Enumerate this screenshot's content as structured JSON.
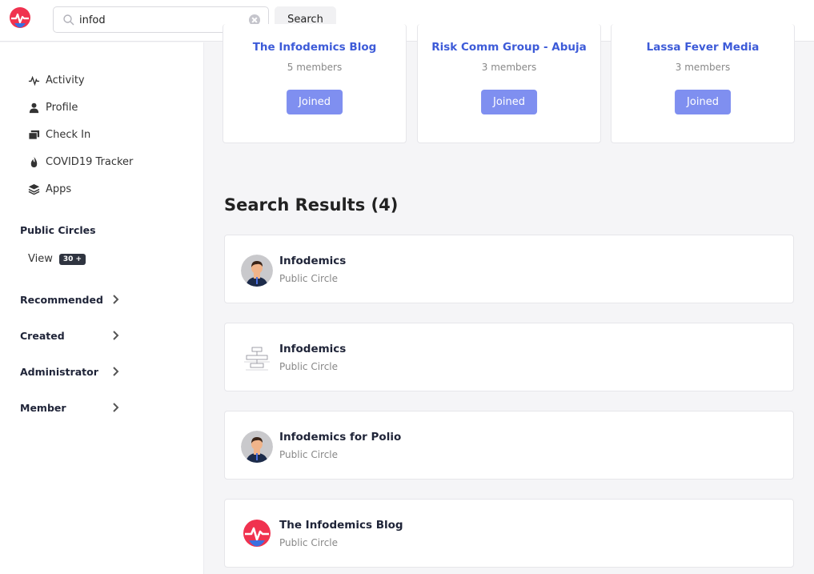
{
  "header": {
    "search": {
      "value": "infod",
      "placeholder": "Search"
    },
    "search_button": "Search"
  },
  "sidebar": {
    "nav": [
      {
        "label": "Activity",
        "icon": "activity-icon"
      },
      {
        "label": "Profile",
        "icon": "profile-icon"
      },
      {
        "label": "Check In",
        "icon": "check-in-icon"
      },
      {
        "label": "COVID19 Tracker",
        "icon": "flame-icon"
      },
      {
        "label": "Apps",
        "icon": "layers-icon"
      }
    ],
    "public_circles": {
      "title": "Public Circles",
      "view_label": "View",
      "view_badge": "30 +"
    },
    "sections": [
      {
        "label": "Recommended"
      },
      {
        "label": "Created"
      },
      {
        "label": "Administrator"
      },
      {
        "label": "Member"
      }
    ]
  },
  "joined_cards": [
    {
      "title": "The Infodemics Blog",
      "members": "5 members",
      "button": "Joined"
    },
    {
      "title": "Risk Comm Group - Abuja",
      "members": "3 members",
      "button": "Joined"
    },
    {
      "title": "Lassa Fever Media",
      "members": "3 members",
      "button": "Joined"
    }
  ],
  "results": {
    "title": "Search Results (4)",
    "items": [
      {
        "name": "Infodemics",
        "type": "Public Circle",
        "avatar": "person-avatar"
      },
      {
        "name": "Infodemics",
        "type": "Public Circle",
        "avatar": "diagram-avatar"
      },
      {
        "name": "Infodemics for Polio",
        "type": "Public Circle",
        "avatar": "person-avatar"
      },
      {
        "name": "The Infodemics Blog",
        "type": "Public Circle",
        "avatar": "logo-avatar"
      }
    ]
  },
  "colors": {
    "accent": "#3d5bd8",
    "joined_button": "#7f8ff0",
    "logo_red": "#f0324f",
    "logo_blue": "#3a6fe0"
  }
}
